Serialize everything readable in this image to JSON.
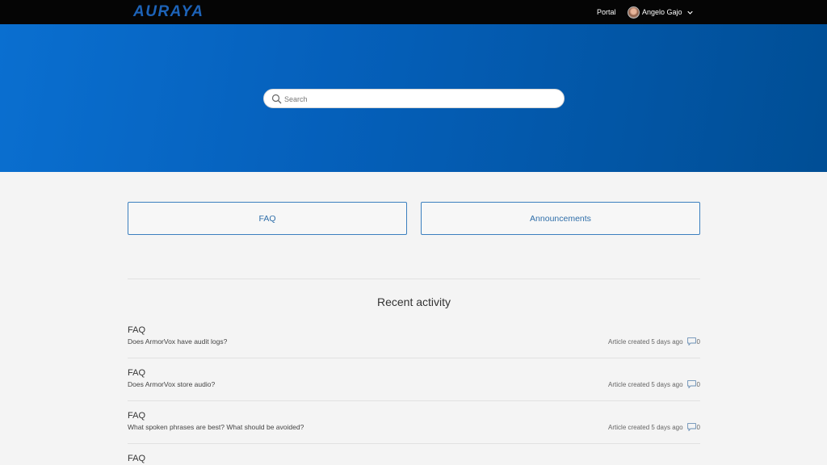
{
  "header": {
    "logo_text": "AURAYA",
    "portal_label": "Portal",
    "user_name": "Angelo Gajo"
  },
  "hero": {
    "search_placeholder": "Search"
  },
  "categories": [
    {
      "label": "FAQ"
    },
    {
      "label": "Announcements"
    }
  ],
  "recent_activity": {
    "title": "Recent activity",
    "items": [
      {
        "category": "FAQ",
        "title": "Does ArmorVox have audit logs?",
        "meta": "Article created 5 days ago",
        "comments": "0"
      },
      {
        "category": "FAQ",
        "title": "Does ArmorVox store audio?",
        "meta": "Article created 5 days ago",
        "comments": "0"
      },
      {
        "category": "FAQ",
        "title": "What spoken phrases are best? What should be avoided?",
        "meta": "Article created 5 days ago",
        "comments": "0"
      },
      {
        "category": "FAQ"
      }
    ]
  },
  "colors": {
    "topbar": "#050505",
    "hero_start": "#0a6fd0",
    "hero_end": "#004e95",
    "logo": "#1d63b8",
    "card_border": "#3b7fbf",
    "card_text": "#2f6ea9",
    "page_bg": "#f4f4f4"
  },
  "icons": [
    "search-icon",
    "chevron-down-icon",
    "comment-icon"
  ]
}
